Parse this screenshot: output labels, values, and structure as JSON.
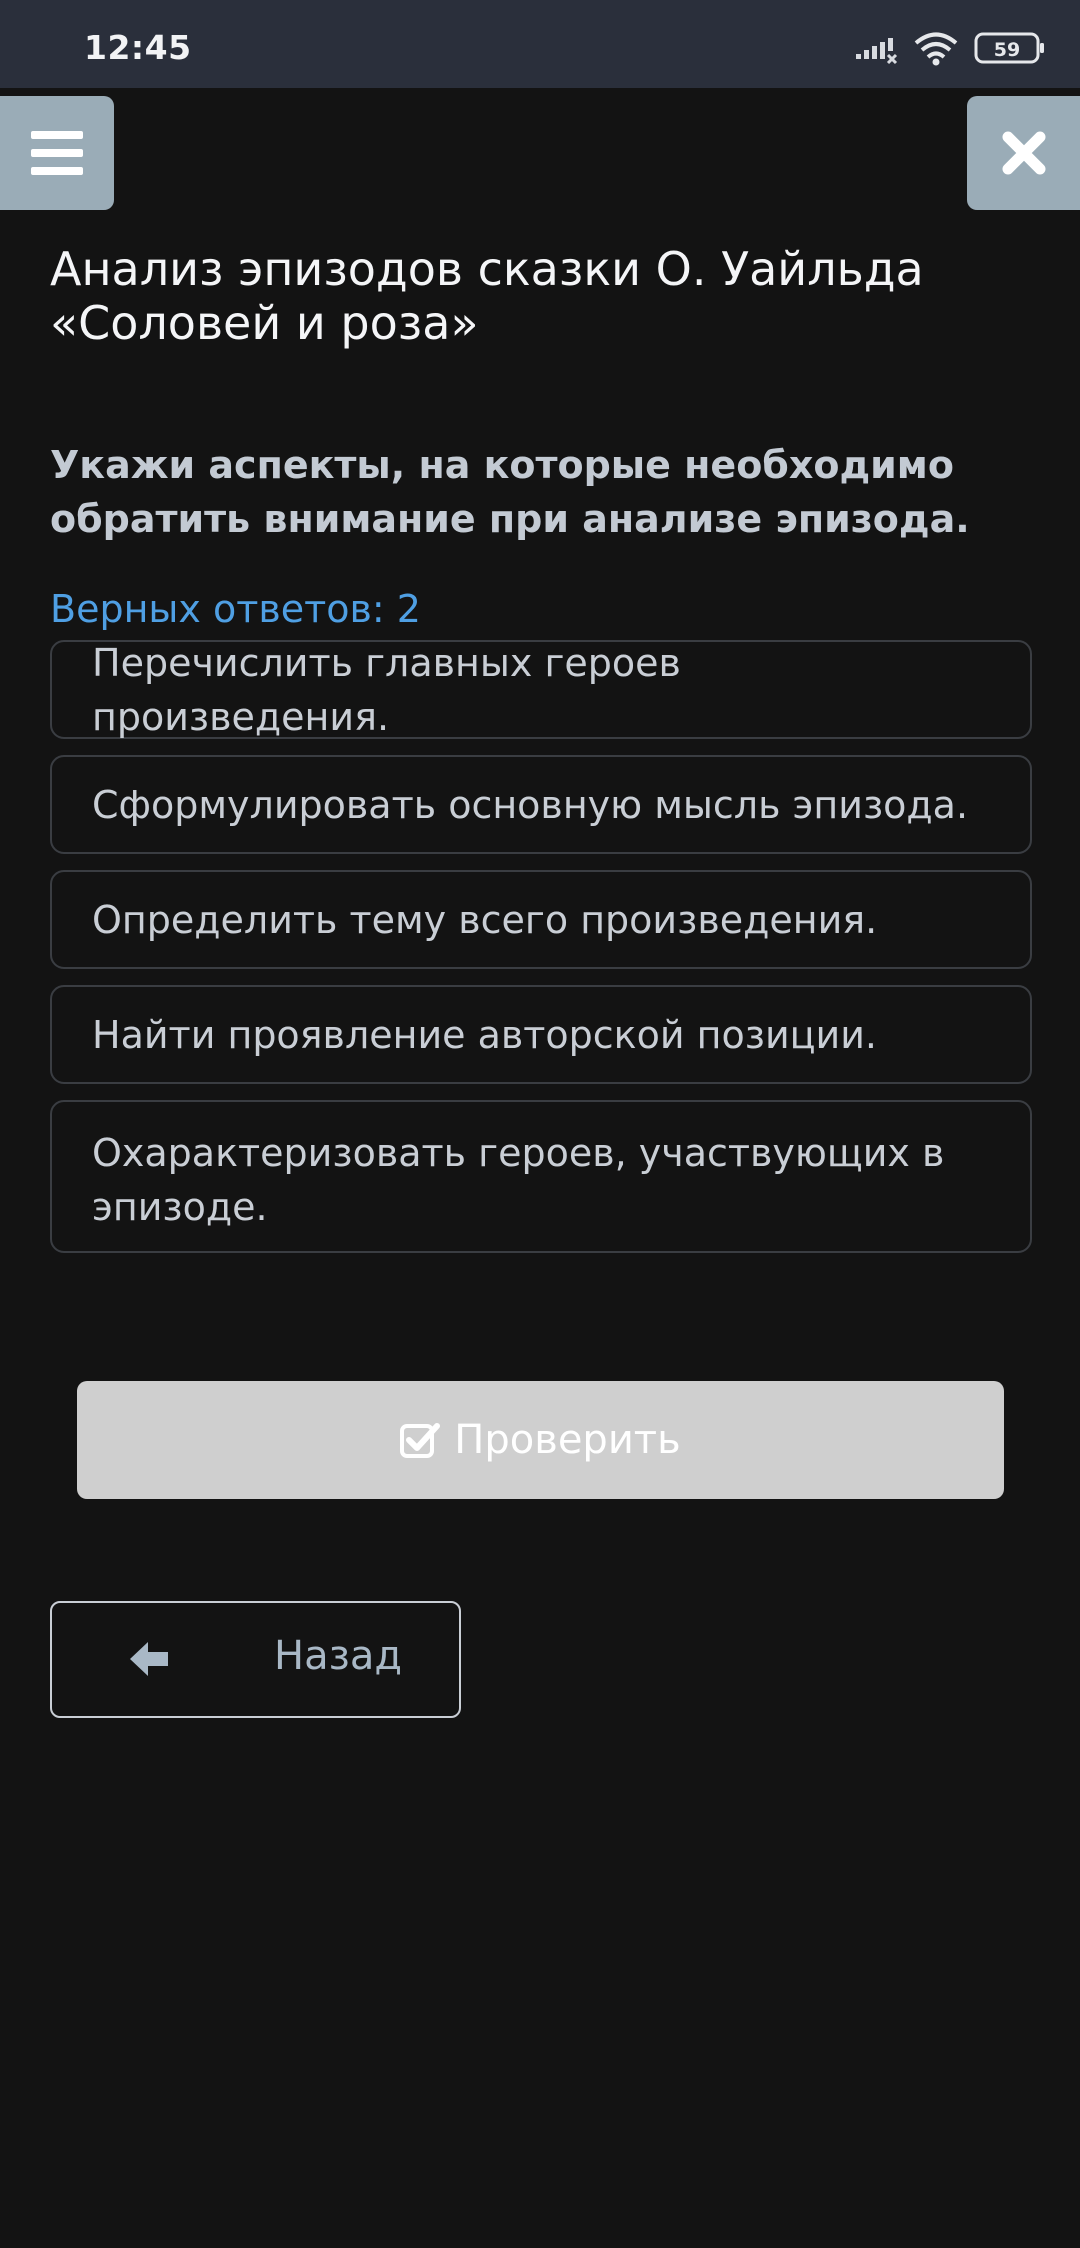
{
  "status_bar": {
    "time": "12:45",
    "battery": "59",
    "icons": [
      "signal-icon",
      "wifi-icon",
      "battery-icon"
    ]
  },
  "header": {
    "menu_icon": "hamburger-icon",
    "close_icon": "close-icon"
  },
  "lesson": {
    "title": "Анализ эпизодов сказки О. Уайльда «Соловей и роза»"
  },
  "question": {
    "text": "Укажи аспекты, на которые необходимо обратить внимание при анализе эпизода.",
    "answers_count": "Верных ответов: 2",
    "options": [
      "Перечислить главных героев произведения.",
      "Сформулировать основную мысль эпизода.",
      "Определить тему всего произведения.",
      "Найти проявление авторской позиции.",
      "Охарактеризовать героев, участвующих в эпизоде."
    ]
  },
  "actions": {
    "check_label": "Проверить",
    "check_icon": "checkbox-check-icon",
    "back_label": "Назад",
    "back_icon": "arrow-left-icon"
  },
  "colors": {
    "background": "#131313",
    "status_bar": "#2a2f3b",
    "accent_blue": "#4f9fe3",
    "icon_button": "#9aacb7",
    "check_button": "#cfcfcf"
  }
}
